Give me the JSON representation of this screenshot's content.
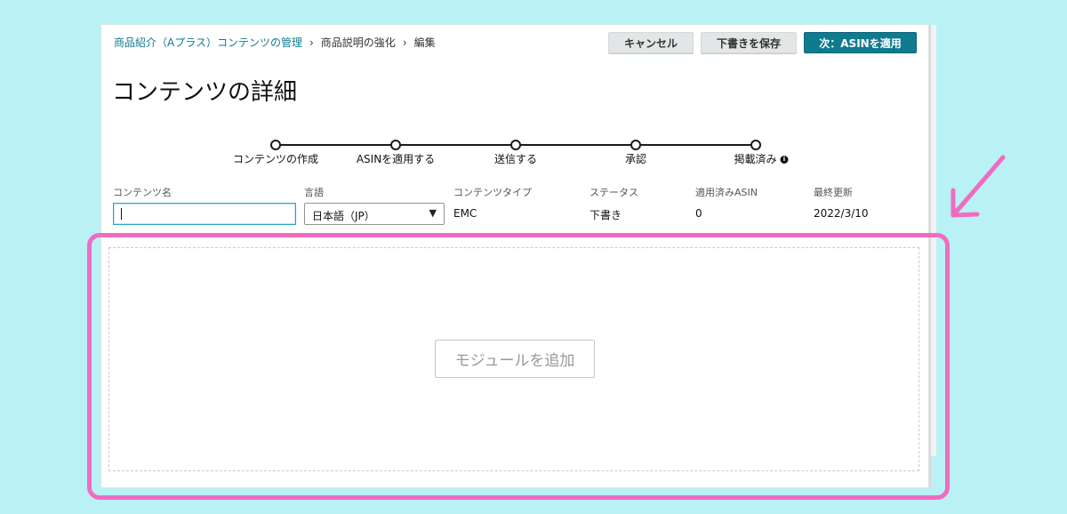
{
  "breadcrumb": {
    "items": [
      "商品紹介（Aプラス）コンテンツの管理",
      "商品説明の強化",
      "編集"
    ]
  },
  "actions": {
    "cancel_label": "キャンセル",
    "save_draft_label": "下書きを保存",
    "next_label": "次：ASINを適用"
  },
  "page_title": "コンテンツの詳細",
  "stepper": {
    "steps": [
      "コンテンツの作成",
      "ASINを適用する",
      "送信する",
      "承認",
      "掲載済み"
    ],
    "info_icon": "info-icon"
  },
  "details": {
    "content_name_label": "コンテンツ名",
    "content_name_value": "",
    "language_label": "言語",
    "language_value": "日本語（JP）",
    "content_type_label": "コンテンツタイプ",
    "content_type_value": "EMC",
    "status_label": "ステータス",
    "status_value": "下書き",
    "applied_asin_label": "適用済みASIN",
    "applied_asin_value": "0",
    "last_updated_label": "最終更新",
    "last_updated_value": "2022/3/10"
  },
  "module": {
    "add_label": "モジュールを追加"
  },
  "colors": {
    "background": "#b9f1f4",
    "primary": "#0f7b8f",
    "highlight": "#f06cc0",
    "link": "#0f7b8f"
  }
}
